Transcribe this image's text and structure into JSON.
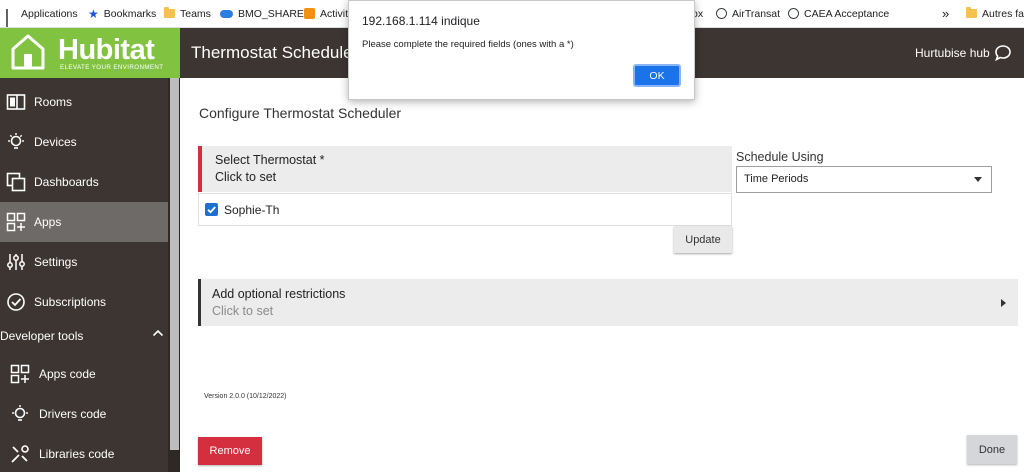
{
  "bookmarks": {
    "items": [
      {
        "label": "Applications",
        "icon": "apps-grid-icon"
      },
      {
        "label": "Bookmarks",
        "icon": "star-icon"
      },
      {
        "label": "Teams",
        "icon": "folder-icon"
      },
      {
        "label": "BMO_SHARE",
        "icon": "cloud-icon"
      },
      {
        "label": "Activiti",
        "icon": "activity-icon"
      },
      {
        "label": "ox",
        "icon": ""
      },
      {
        "label": "AirTransat",
        "icon": "globe-icon"
      },
      {
        "label": "CAEA Acceptance",
        "icon": "globe-icon"
      },
      {
        "label": "»",
        "icon": ""
      },
      {
        "label": "Autres fav",
        "icon": "folder-icon"
      }
    ]
  },
  "logo": {
    "name": "Hubitat",
    "tagline": "ELEVATE YOUR ENVIRONMENT"
  },
  "header": {
    "title": "Thermostat Scheduler",
    "hub_name": "Hurtubise hub"
  },
  "sidebar": {
    "items": [
      {
        "label": "Rooms",
        "icon": "rooms-icon"
      },
      {
        "label": "Devices",
        "icon": "bulb-icon"
      },
      {
        "label": "Dashboards",
        "icon": "dashboards-icon"
      },
      {
        "label": "Apps",
        "icon": "apps-icon",
        "active": true
      },
      {
        "label": "Settings",
        "icon": "sliders-icon"
      },
      {
        "label": "Subscriptions",
        "icon": "check-circle-icon"
      }
    ],
    "developer_tools": {
      "label": "Developer tools",
      "items": [
        {
          "label": "Apps code",
          "icon": "apps-code-icon"
        },
        {
          "label": "Drivers code",
          "icon": "bulb-icon"
        },
        {
          "label": "Libraries code",
          "icon": "wrench-icon"
        }
      ]
    }
  },
  "main": {
    "title": "Configure Thermostat Scheduler",
    "select_thermostat": {
      "label": "Select Thermostat *",
      "value": "Click to set"
    },
    "selected_device": {
      "label": "Sophie-Th",
      "checked": true
    },
    "update_label": "Update",
    "schedule_using": {
      "label": "Schedule Using",
      "value": "Time Periods"
    },
    "restrictions": {
      "label": "Add optional restrictions",
      "value": "Click to set"
    },
    "version": "Version 2.0.0 (10/12/2022)",
    "remove_label": "Remove",
    "done_label": "Done"
  },
  "dialog": {
    "title": "192.168.1.114 indique",
    "message": "Please complete the required fields (ones with a *)",
    "ok_label": "OK"
  },
  "colors": {
    "brand_green": "#81c341",
    "sidebar_bg": "#3c3532",
    "required_red": "#d32f3e",
    "dialog_button": "#1a73e8"
  }
}
